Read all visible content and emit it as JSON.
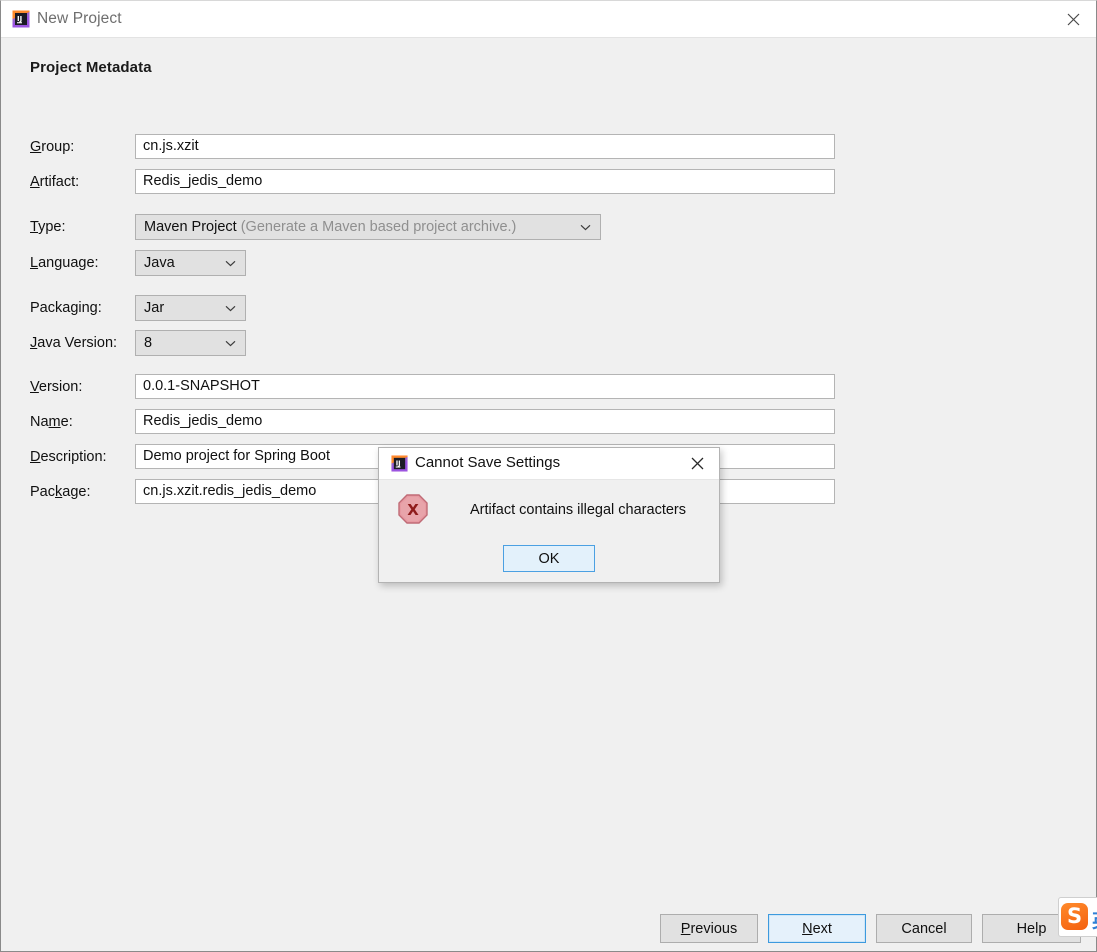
{
  "window": {
    "title": "New Project",
    "app_icon": "intellij-idea-icon",
    "close_icon": "close-icon"
  },
  "main": {
    "section_title": "Project Metadata",
    "fields": [
      {
        "label_pre": "",
        "label_mnemonic": "G",
        "label_post": "roup:",
        "label_full": "Group:",
        "type": "text",
        "value": "cn.js.xzit",
        "name": "group"
      },
      {
        "label_pre": "",
        "label_mnemonic": "A",
        "label_post": "rtifact:",
        "label_full": "Artifact:",
        "type": "text",
        "value": "Redis_jedis_demo",
        "name": "artifact"
      },
      {
        "label_pre": "",
        "label_mnemonic": "T",
        "label_post": "ype:",
        "label_full": "Type:",
        "type": "combo",
        "value": "Maven Project",
        "hint": "(Generate a Maven based project archive.)",
        "name": "type"
      },
      {
        "label_pre": "",
        "label_mnemonic": "L",
        "label_post": "anguage:",
        "label_full": "Language:",
        "type": "combo",
        "value": "Java",
        "hint": "",
        "name": "language"
      },
      {
        "label_pre": "Packa",
        "label_mnemonic": "g",
        "label_post": "ing:",
        "label_full": "Packaging:",
        "type": "combo",
        "value": "Jar",
        "hint": "",
        "name": "packaging"
      },
      {
        "label_pre": "",
        "label_mnemonic": "J",
        "label_post": "ava Version:",
        "label_full": "Java Version:",
        "type": "combo",
        "value": "8",
        "hint": "",
        "name": "java-version"
      },
      {
        "label_pre": "",
        "label_mnemonic": "V",
        "label_post": "ersion:",
        "label_full": "Version:",
        "type": "text",
        "value": "0.0.1-SNAPSHOT",
        "name": "version"
      },
      {
        "label_pre": "Na",
        "label_mnemonic": "m",
        "label_post": "e:",
        "label_full": "Name:",
        "type": "text",
        "value": "Redis_jedis_demo",
        "name": "name"
      },
      {
        "label_pre": "",
        "label_mnemonic": "D",
        "label_post": "escription:",
        "label_full": "Description:",
        "type": "text",
        "value": "Demo project for Spring Boot",
        "name": "description"
      },
      {
        "label_pre": "Pac",
        "label_mnemonic": "k",
        "label_post": "age:",
        "label_full": "Package:",
        "type": "text",
        "value": "cn.js.xzit.redis_jedis_demo",
        "name": "package"
      }
    ],
    "dropdown_caret_icon": "chevron-down-icon"
  },
  "dialog": {
    "title": "Cannot Save Settings",
    "app_icon": "intellij-idea-icon",
    "close_icon": "close-icon",
    "error_icon": "error-octagon-icon",
    "error_glyph": "X",
    "message": "Artifact contains illegal characters",
    "ok_label": "OK"
  },
  "footer": {
    "buttons": [
      {
        "name": "previous",
        "pre": "",
        "mnemonic": "P",
        "post": "revious",
        "full": "Previous",
        "focused": false
      },
      {
        "name": "next",
        "pre": "",
        "mnemonic": "N",
        "post": "ext",
        "full": "Next",
        "focused": true
      },
      {
        "name": "cancel",
        "pre": "Cancel",
        "mnemonic": "",
        "post": "",
        "full": "Cancel",
        "focused": false
      },
      {
        "name": "help",
        "pre": "Help",
        "mnemonic": "",
        "post": "",
        "full": "Help",
        "focused": false
      }
    ]
  },
  "ime": {
    "logo_letter": "S",
    "mode_label": "英"
  },
  "colors": {
    "window_bg": "#f0f0f0",
    "titlebar_bg": "#ffffff",
    "field_bg": "#ffffff",
    "combo_bg": "#e1e1e1",
    "focus_blue": "#3d9ade",
    "focus_fill": "#e5f1fb",
    "error_red": "#8f1b1b",
    "error_fill": "#e8a0a6",
    "ime_orange": "#f4600f",
    "ime_blue": "#2f7fd4"
  }
}
